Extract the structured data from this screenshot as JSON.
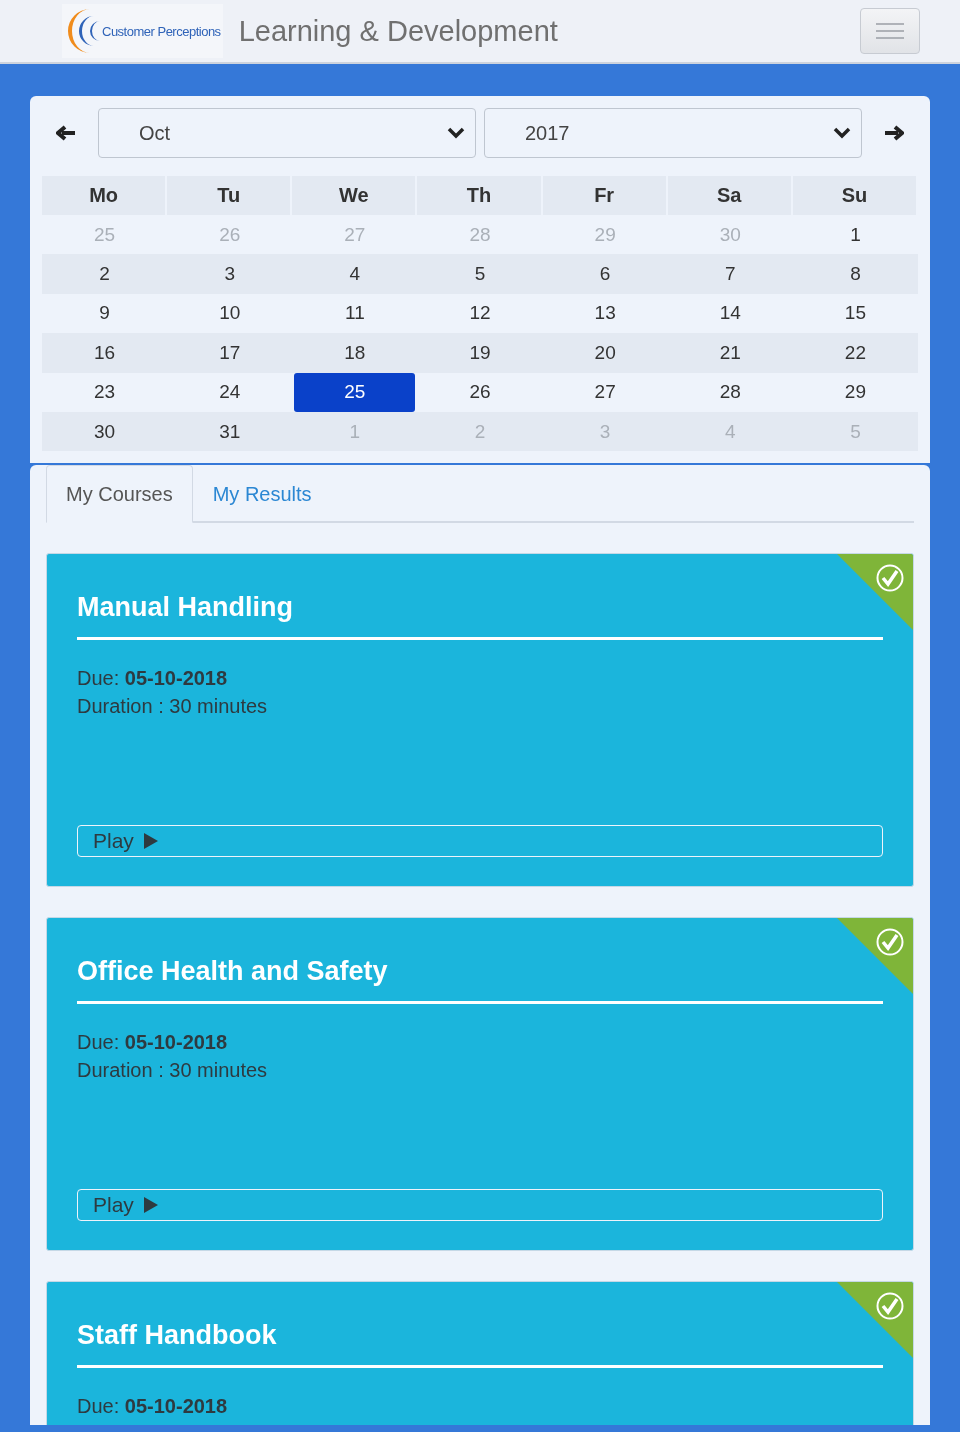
{
  "header": {
    "logo_text": "Customer Perceptions",
    "title": "Learning & Development"
  },
  "calendar": {
    "month": "Oct",
    "year": "2017",
    "weekdays": [
      "Mo",
      "Tu",
      "We",
      "Th",
      "Fr",
      "Sa",
      "Su"
    ],
    "weeks": [
      [
        {
          "day": "25",
          "muted": true,
          "selected": false
        },
        {
          "day": "26",
          "muted": true,
          "selected": false
        },
        {
          "day": "27",
          "muted": true,
          "selected": false
        },
        {
          "day": "28",
          "muted": true,
          "selected": false
        },
        {
          "day": "29",
          "muted": true,
          "selected": false
        },
        {
          "day": "30",
          "muted": true,
          "selected": false
        },
        {
          "day": "1",
          "muted": false,
          "selected": false
        }
      ],
      [
        {
          "day": "2",
          "muted": false,
          "selected": false
        },
        {
          "day": "3",
          "muted": false,
          "selected": false
        },
        {
          "day": "4",
          "muted": false,
          "selected": false
        },
        {
          "day": "5",
          "muted": false,
          "selected": false
        },
        {
          "day": "6",
          "muted": false,
          "selected": false
        },
        {
          "day": "7",
          "muted": false,
          "selected": false
        },
        {
          "day": "8",
          "muted": false,
          "selected": false
        }
      ],
      [
        {
          "day": "9",
          "muted": false,
          "selected": false
        },
        {
          "day": "10",
          "muted": false,
          "selected": false
        },
        {
          "day": "11",
          "muted": false,
          "selected": false
        },
        {
          "day": "12",
          "muted": false,
          "selected": false
        },
        {
          "day": "13",
          "muted": false,
          "selected": false
        },
        {
          "day": "14",
          "muted": false,
          "selected": false
        },
        {
          "day": "15",
          "muted": false,
          "selected": false
        }
      ],
      [
        {
          "day": "16",
          "muted": false,
          "selected": false
        },
        {
          "day": "17",
          "muted": false,
          "selected": false
        },
        {
          "day": "18",
          "muted": false,
          "selected": false
        },
        {
          "day": "19",
          "muted": false,
          "selected": false
        },
        {
          "day": "20",
          "muted": false,
          "selected": false
        },
        {
          "day": "21",
          "muted": false,
          "selected": false
        },
        {
          "day": "22",
          "muted": false,
          "selected": false
        }
      ],
      [
        {
          "day": "23",
          "muted": false,
          "selected": false
        },
        {
          "day": "24",
          "muted": false,
          "selected": false
        },
        {
          "day": "25",
          "muted": false,
          "selected": true
        },
        {
          "day": "26",
          "muted": false,
          "selected": false
        },
        {
          "day": "27",
          "muted": false,
          "selected": false
        },
        {
          "day": "28",
          "muted": false,
          "selected": false
        },
        {
          "day": "29",
          "muted": false,
          "selected": false
        }
      ],
      [
        {
          "day": "30",
          "muted": false,
          "selected": false
        },
        {
          "day": "31",
          "muted": false,
          "selected": false
        },
        {
          "day": "1",
          "muted": true,
          "selected": false
        },
        {
          "day": "2",
          "muted": true,
          "selected": false
        },
        {
          "day": "3",
          "muted": true,
          "selected": false
        },
        {
          "day": "4",
          "muted": true,
          "selected": false
        },
        {
          "day": "5",
          "muted": true,
          "selected": false
        }
      ]
    ]
  },
  "tabs": [
    {
      "label": "My Courses",
      "selected": true
    },
    {
      "label": "My Results",
      "selected": false
    }
  ],
  "courses": [
    {
      "title": "Manual Handling",
      "due_label": "Due:",
      "due": "05-10-2018",
      "duration": "Duration : 30 minutes",
      "play": "Play",
      "completed": true
    },
    {
      "title": "Office Health and Safety",
      "due_label": "Due:",
      "due": "05-10-2018",
      "duration": "Duration : 30 minutes",
      "play": "Play",
      "completed": true
    },
    {
      "title": "Staff Handbook",
      "due_label": "Due:",
      "due": "05-10-2018",
      "completed": true
    }
  ]
}
